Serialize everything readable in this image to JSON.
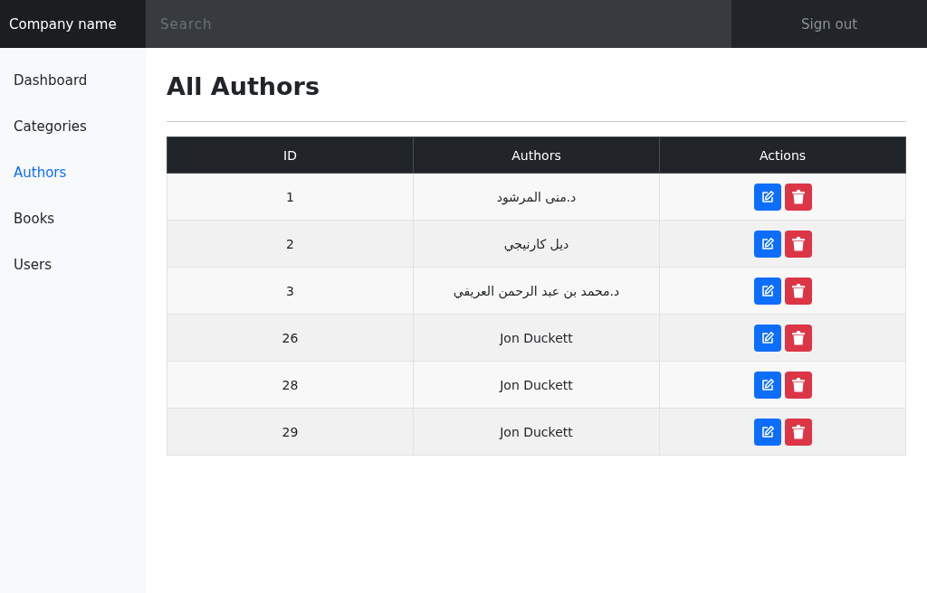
{
  "navbar": {
    "brand": "Company name",
    "search": {
      "placeholder": "Search"
    },
    "sign_out": "Sign out"
  },
  "sidebar": {
    "items": [
      {
        "label": "Dashboard",
        "selected": false
      },
      {
        "label": "Categories",
        "selected": false
      },
      {
        "label": "Authors",
        "selected": true
      },
      {
        "label": "Books",
        "selected": false
      },
      {
        "label": "Users",
        "selected": false
      }
    ]
  },
  "page": {
    "title": "All Authors"
  },
  "table": {
    "columns": [
      "ID",
      "Authors",
      "Actions"
    ],
    "rows": [
      {
        "id": "1",
        "author": "د.منى المرشود"
      },
      {
        "id": "2",
        "author": "ديل كارنيجي"
      },
      {
        "id": "3",
        "author": "د.محمد بن عبد الرحمن العريفي"
      },
      {
        "id": "26",
        "author": "Jon Duckett"
      },
      {
        "id": "28",
        "author": "Jon Duckett"
      },
      {
        "id": "29",
        "author": "Jon Duckett"
      }
    ]
  }
}
